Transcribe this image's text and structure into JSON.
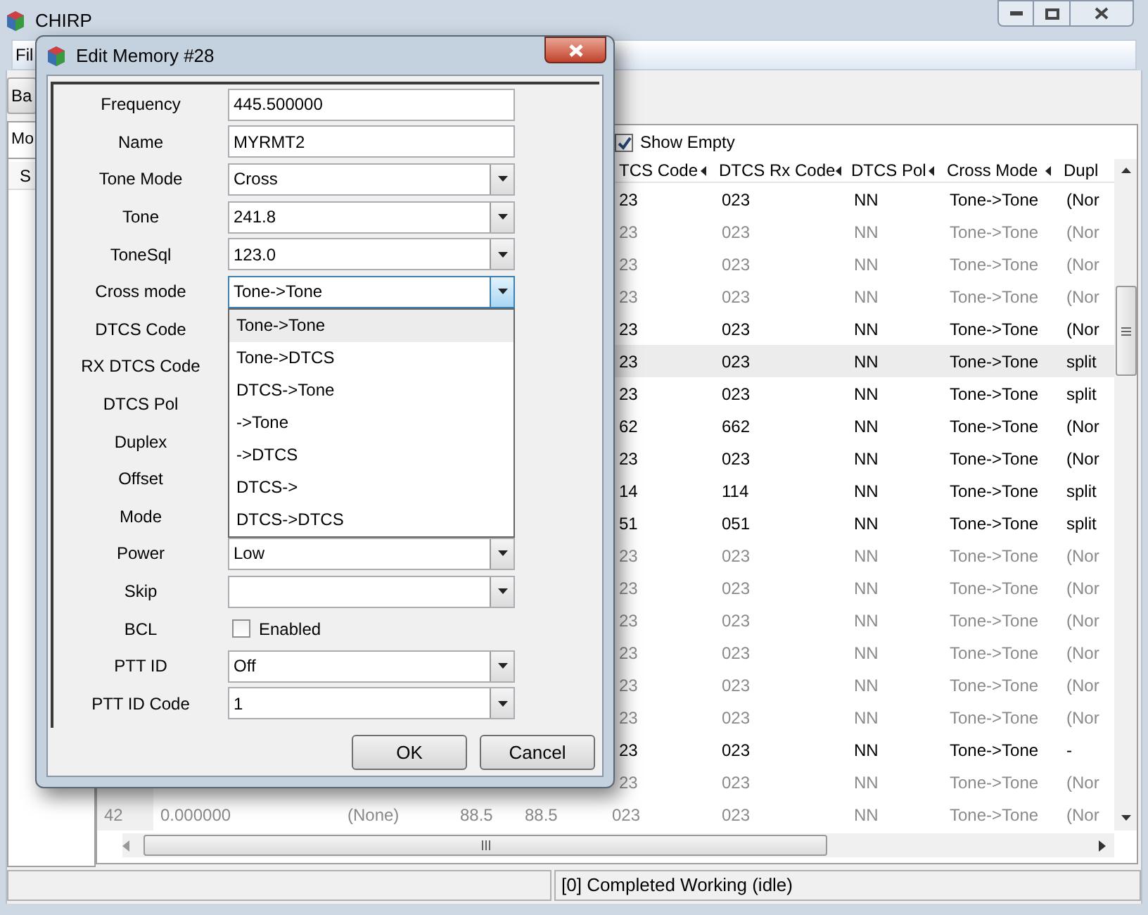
{
  "window": {
    "title": "CHIRP"
  },
  "menu": [
    {
      "label": "Fil"
    }
  ],
  "toolbar": [
    {
      "label": "Ba"
    }
  ],
  "tabs": [
    {
      "label": "Mo",
      "selected": true
    }
  ],
  "sidebar": {
    "header": "S"
  },
  "show_empty": {
    "label": "Show Empty",
    "checked": true
  },
  "table": {
    "columns": [
      {
        "label": "TCS Code"
      },
      {
        "label": "DTCS Rx Code"
      },
      {
        "label": "DTCS Pol"
      },
      {
        "label": "Cross Mode"
      },
      {
        "label": "Dupl"
      }
    ],
    "rows": [
      {
        "cells": [
          "23",
          "023",
          "NN",
          "Tone->Tone",
          "(Nor"
        ],
        "dimmed": false,
        "selected": false
      },
      {
        "cells": [
          "23",
          "023",
          "NN",
          "Tone->Tone",
          "(Nor"
        ],
        "dimmed": true,
        "selected": false
      },
      {
        "cells": [
          "23",
          "023",
          "NN",
          "Tone->Tone",
          "(Nor"
        ],
        "dimmed": true,
        "selected": false
      },
      {
        "cells": [
          "23",
          "023",
          "NN",
          "Tone->Tone",
          "(Nor"
        ],
        "dimmed": true,
        "selected": false
      },
      {
        "cells": [
          "23",
          "023",
          "NN",
          "Tone->Tone",
          "(Nor"
        ],
        "dimmed": false,
        "selected": false
      },
      {
        "cells": [
          "23",
          "023",
          "NN",
          "Tone->Tone",
          "split"
        ],
        "dimmed": false,
        "selected": true
      },
      {
        "cells": [
          "23",
          "023",
          "NN",
          "Tone->Tone",
          "split"
        ],
        "dimmed": false,
        "selected": false
      },
      {
        "cells": [
          "62",
          "662",
          "NN",
          "Tone->Tone",
          "(Nor"
        ],
        "dimmed": false,
        "selected": false
      },
      {
        "cells": [
          "23",
          "023",
          "NN",
          "Tone->Tone",
          "(Nor"
        ],
        "dimmed": false,
        "selected": false
      },
      {
        "cells": [
          "14",
          "114",
          "NN",
          "Tone->Tone",
          "split"
        ],
        "dimmed": false,
        "selected": false
      },
      {
        "cells": [
          "51",
          "051",
          "NN",
          "Tone->Tone",
          "split"
        ],
        "dimmed": false,
        "selected": false
      },
      {
        "cells": [
          "23",
          "023",
          "NN",
          "Tone->Tone",
          "(Nor"
        ],
        "dimmed": true,
        "selected": false
      },
      {
        "cells": [
          "23",
          "023",
          "NN",
          "Tone->Tone",
          "(Nor"
        ],
        "dimmed": true,
        "selected": false
      },
      {
        "cells": [
          "23",
          "023",
          "NN",
          "Tone->Tone",
          "(Nor"
        ],
        "dimmed": true,
        "selected": false
      },
      {
        "cells": [
          "23",
          "023",
          "NN",
          "Tone->Tone",
          "(Nor"
        ],
        "dimmed": true,
        "selected": false
      },
      {
        "cells": [
          "23",
          "023",
          "NN",
          "Tone->Tone",
          "(Nor"
        ],
        "dimmed": true,
        "selected": false
      },
      {
        "cells": [
          "23",
          "023",
          "NN",
          "Tone->Tone",
          "(Nor"
        ],
        "dimmed": true,
        "selected": false
      },
      {
        "cells": [
          "23",
          "023",
          "NN",
          "Tone->Tone",
          "-"
        ],
        "dimmed": false,
        "selected": false
      },
      {
        "cells": [
          "23",
          "023",
          "NN",
          "Tone->Tone",
          "(Nor"
        ],
        "dimmed": true,
        "selected": false
      },
      {
        "cells": [
          "42",
          "0.000000",
          "(None)",
          "88.5",
          "88.5",
          "023",
          "023",
          "NN",
          "Tone->Tone",
          "(Nor"
        ],
        "dimmed": true,
        "selected": false
      }
    ]
  },
  "status_bar": {
    "text": "[0] Completed Working (idle)"
  },
  "dialog": {
    "title": "Edit Memory #28",
    "fields": [
      {
        "label": "Frequency",
        "kind": "text",
        "value": "445.500000"
      },
      {
        "label": "Name",
        "kind": "text",
        "value": "MYRMT2"
      },
      {
        "label": "Tone Mode",
        "kind": "combo",
        "value": "Cross",
        "focused": false
      },
      {
        "label": "Tone",
        "kind": "combo",
        "value": "241.8",
        "focused": false
      },
      {
        "label": "ToneSql",
        "kind": "combo",
        "value": "123.0",
        "focused": false
      },
      {
        "label": "Cross mode",
        "kind": "combo",
        "value": "Tone->Tone",
        "focused": true
      },
      {
        "label": "DTCS Code"
      },
      {
        "label": "RX DTCS Code"
      },
      {
        "label": "DTCS Pol"
      },
      {
        "label": "Duplex"
      },
      {
        "label": "Offset"
      },
      {
        "label": "Mode"
      },
      {
        "label": "Power",
        "kind": "combo",
        "value": "Low",
        "focused": false
      },
      {
        "label": "Skip",
        "kind": "combo",
        "focused": false
      },
      {
        "label": "BCL",
        "kind": "checkbox",
        "text": "Enabled",
        "checked": false
      },
      {
        "label": "PTT ID",
        "kind": "combo",
        "value": "Off",
        "focused": false
      },
      {
        "label": "PTT ID Code",
        "kind": "combo",
        "value": "1",
        "focused": false
      }
    ],
    "dropdown": [
      {
        "label": "Tone->Tone",
        "selected": true
      },
      {
        "label": "Tone->DTCS",
        "selected": false
      },
      {
        "label": "DTCS->Tone",
        "selected": false
      },
      {
        "label": "->Tone",
        "selected": false
      },
      {
        "label": "->DTCS",
        "selected": false
      },
      {
        "label": "DTCS->",
        "selected": false
      },
      {
        "label": "DTCS->DTCS",
        "selected": false
      }
    ],
    "buttons": [
      {
        "label": "OK"
      },
      {
        "label": "Cancel"
      }
    ]
  }
}
